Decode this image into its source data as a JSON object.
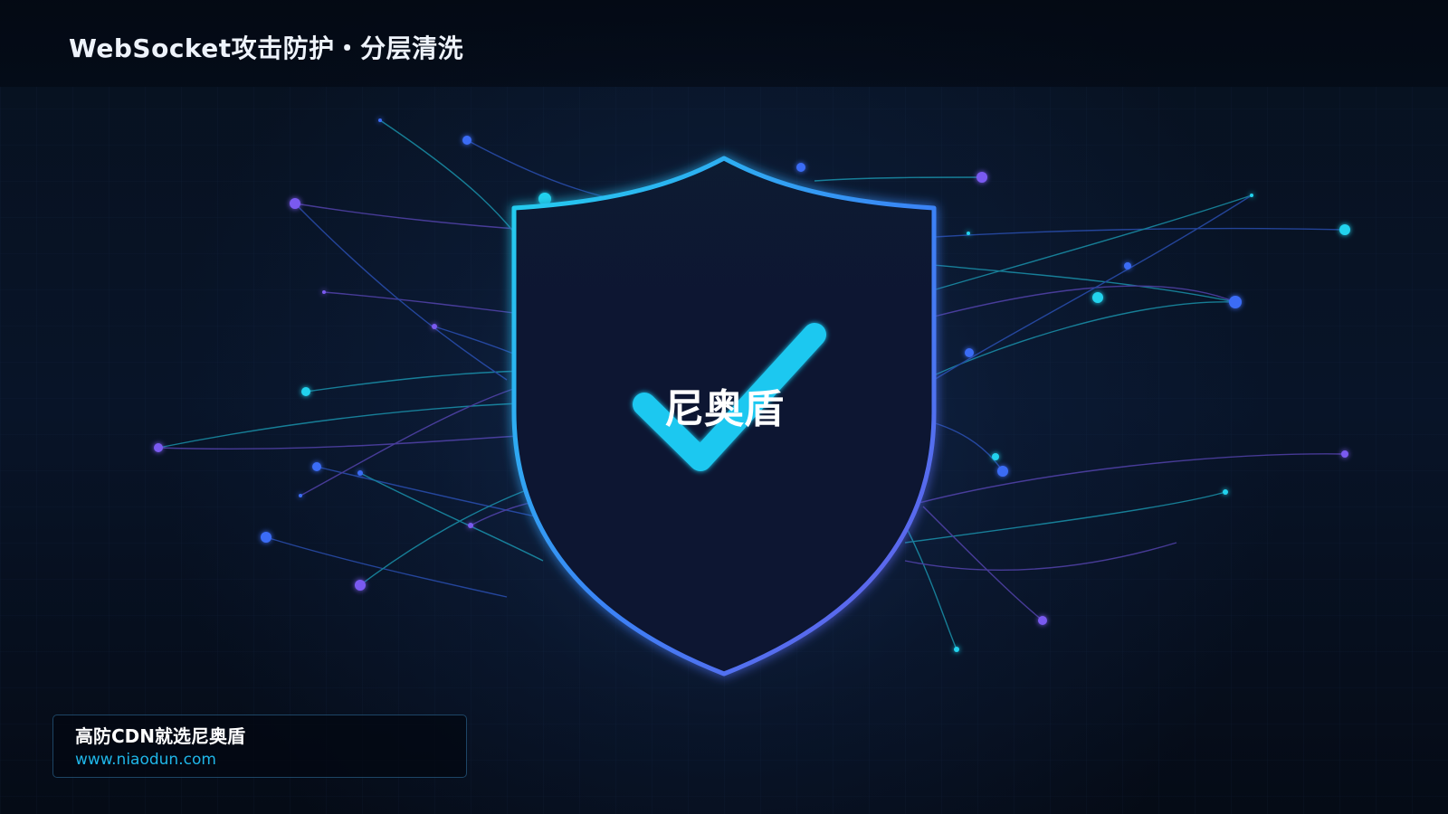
{
  "header": {
    "title": "WebSocket攻击防护・分层清洗"
  },
  "shield": {
    "label": "尼奥盾",
    "icon": "shield-check-icon"
  },
  "footer_card": {
    "slogan": "高防CDN就选尼奥盾",
    "url": "www.niaodun.com"
  },
  "colors": {
    "background": "#060d1a",
    "accent_cyan": "#22d3ee",
    "accent_blue": "#3b6cf6",
    "accent_violet": "#6d5ae8",
    "check": "#1ec8f0",
    "text_primary": "#ffffff",
    "url_text": "#1fb6e8"
  }
}
